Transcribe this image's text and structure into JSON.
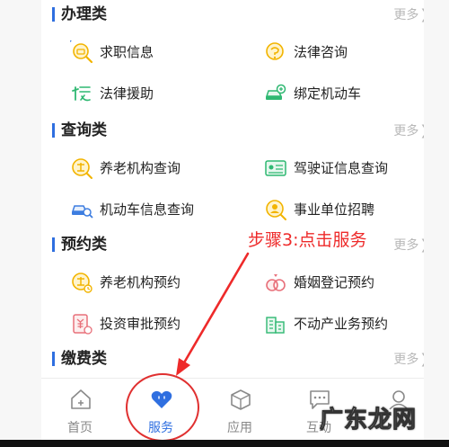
{
  "sections": [
    {
      "title": "办理类",
      "more": "更多",
      "items": [
        "求职信息",
        "法律咨询",
        "法律援助",
        "绑定机动车"
      ]
    },
    {
      "title": "查询类",
      "more": "更多",
      "items": [
        "养老机构查询",
        "驾驶证信息查询",
        "机动车信息查询",
        "事业单位招聘"
      ]
    },
    {
      "title": "预约类",
      "more": "更多",
      "items": [
        "养老机构预约",
        "婚姻登记预约",
        "投资审批预约",
        "不动产业务预约"
      ]
    },
    {
      "title": "缴费类",
      "more": "更多",
      "items": []
    }
  ],
  "more_chevron": "❯",
  "tabbar": {
    "tabs": [
      {
        "label": "首页",
        "icon": "home-icon",
        "active": false
      },
      {
        "label": "服务",
        "icon": "heart-service-icon",
        "active": true
      },
      {
        "label": "应用",
        "icon": "cube-icon",
        "active": false
      },
      {
        "label": "互动",
        "icon": "chat-icon",
        "active": false
      },
      {
        "label": "",
        "icon": "user-icon",
        "active": false
      }
    ]
  },
  "annotation": {
    "text": "步骤3:点击服务"
  },
  "watermark": {
    "text": "广东龙网"
  },
  "colors": {
    "accent": "#2f6fe0",
    "annotation": "#ee2a2a",
    "icon_yellow": "#f2b400",
    "icon_green": "#2fb872",
    "icon_blue": "#3d7de0"
  }
}
